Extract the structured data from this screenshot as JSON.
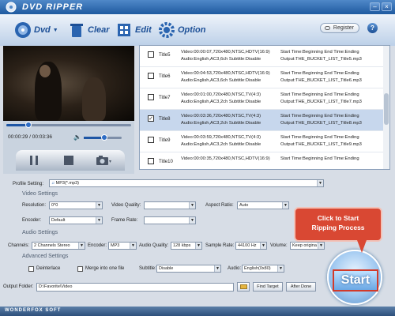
{
  "app": {
    "title": "DVD RIPPER",
    "register_label": "Register",
    "help_label": "?"
  },
  "window_controls": {
    "minimize": "–",
    "close": "×"
  },
  "toolbar": {
    "dvd_label": "Dvd",
    "clear_label": "Clear",
    "edit_label": "Edit",
    "option_label": "Option"
  },
  "player": {
    "time_current": "00:00:29",
    "time_separator": " / ",
    "time_total": "00:03:36",
    "seek_progress": 0.18,
    "volume_level": 0.55
  },
  "files": [
    {
      "title": "Title5",
      "checked": false,
      "info1": "Video:00:00:07,720x480,NTSC,HDTV(16:9)",
      "info2": "Audio:English,AC3,6ch Subtitle:Disable",
      "out1": "Start Time:Beginning End Time:Ending",
      "out2": "Output:THE_BUCKET_LIST_Title5.mp3"
    },
    {
      "title": "Title6",
      "checked": false,
      "info1": "Video:00:04:53,720x480,NTSC,HDTV(16:9)",
      "info2": "Audio:English,AC3,6ch Subtitle:Disable",
      "out1": "Start Time:Beginning End Time:Ending",
      "out2": "Output:THE_BUCKET_LIST_Title6.mp3"
    },
    {
      "title": "Title7",
      "checked": false,
      "info1": "Video:00:01:00,720x480,NTSC,TV(4:3)",
      "info2": "Audio:English,AC3,2ch Subtitle:Disable",
      "out1": "Start Time:Beginning End Time:Ending",
      "out2": "Output:THE_BUCKET_LIST_Title7.mp3"
    },
    {
      "title": "Title8",
      "checked": true,
      "info1": "Video:00:03:36,720x480,NTSC,TV(4:3)",
      "info2": "Audio:English,AC3,2ch Subtitle:Disable",
      "out1": "Start Time:Beginning End Time:Ending",
      "out2": "Output:THE_BUCKET_LIST_Title8.mp3"
    },
    {
      "title": "Title9",
      "checked": false,
      "info1": "Video:00:03:59,720x480,NTSC,TV(4:3)",
      "info2": "Audio:English,AC3,2ch Subtitle:Disable",
      "out1": "Start Time:Beginning End Time:Ending",
      "out2": "Output:THE_BUCKET_LIST_Title9.mp3"
    },
    {
      "title": "Title10",
      "checked": false,
      "info1": "Video:00:00:35,720x480,NTSC,HDTV(16:9)",
      "info2": "",
      "out1": "Start Time:Beginning End Time:Ending",
      "out2": ""
    }
  ],
  "settings": {
    "profile_label": "Profile Setting:",
    "profile_value": "MP3(*.mp3)",
    "video_section": "Video Settings",
    "resolution_label": "Resolution:",
    "resolution_value": "0*0",
    "video_quality_label": "Video Quality:",
    "video_quality_value": "",
    "aspect_label": "Aspect Ratio:",
    "aspect_value": "Auto",
    "encoder_label": "Encoder:",
    "encoder_value": "Default",
    "frame_rate_label": "Frame Rate:",
    "frame_rate_value": "",
    "audio_section": "Audio Settings",
    "channels_label": "Channels:",
    "channels_value": "2 Channels Stereo",
    "audio_encoder_label": "Encoder:",
    "audio_encoder_value": "MP3",
    "audio_quality_label": "Audio Quality:",
    "audio_quality_value": "128 kbps",
    "sample_rate_label": "Sample Rate:",
    "sample_rate_value": "44100 Hz",
    "volume_label": "Volume:",
    "volume_value": "Keep origina",
    "advanced_section": "Advanced Settings",
    "deinterlace_label": "Deinterlace",
    "merge_label": "Merge into one file",
    "subtitle_label": "Subtitle:",
    "subtitle_value": "Disable",
    "audio_label": "Audio:",
    "audio_value": "English(0x80)"
  },
  "output": {
    "label": "Output Folder:",
    "path": "D:\\Favorite\\Video",
    "find_target": "Find Target",
    "after_done": "After Done"
  },
  "callout": {
    "line1": "Click to Start",
    "line2": "Ripping Process"
  },
  "start_label": "Start",
  "footer_brand": "WONDERFOX SOFT",
  "colors": {
    "accent": "#1f5aa0",
    "callout": "#d94833",
    "start_border": "#d23a2a"
  }
}
